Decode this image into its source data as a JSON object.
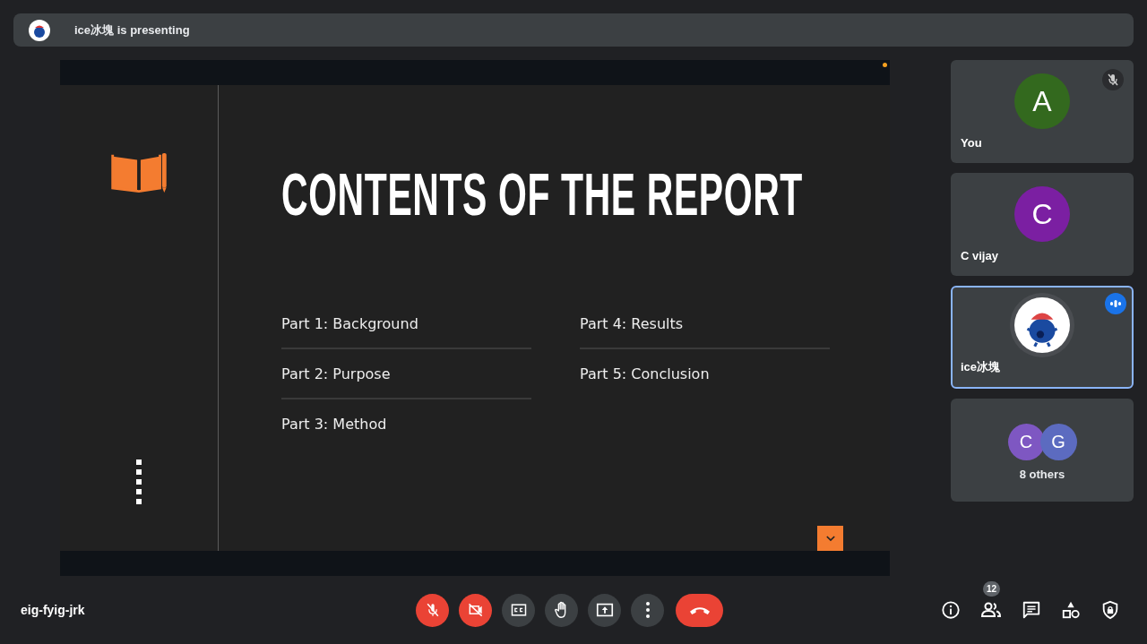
{
  "banner": {
    "text": "ice冰塊 is presenting"
  },
  "slide": {
    "title": "CONTENTS OF THE REPORT",
    "columns": [
      [
        "Part 1: Background",
        "Part 2: Purpose",
        "Part 3: Method"
      ],
      [
        "Part 4: Results",
        "Part 5: Conclusion"
      ]
    ]
  },
  "participants": [
    {
      "kind": "initial",
      "initial": "A",
      "name": "You",
      "color": "#33691e",
      "muted": true,
      "speaking": false
    },
    {
      "kind": "initial",
      "initial": "C",
      "name": "C vijay",
      "color": "#7b1fa2",
      "muted": false,
      "speaking": false
    },
    {
      "kind": "picture",
      "name": "ice冰塊",
      "muted": false,
      "speaking": true
    }
  ],
  "others": {
    "avatars": [
      {
        "initial": "C",
        "color": "#7e57c2"
      },
      {
        "initial": "G",
        "color": "#5c6bc0"
      }
    ],
    "label": "8 others"
  },
  "meeting_code": "eig-fyig-jrk",
  "controls": [
    {
      "kind": "mic",
      "on": false
    },
    {
      "kind": "camera",
      "on": false
    },
    {
      "kind": "captions",
      "on": false
    },
    {
      "kind": "hand",
      "on": false
    },
    {
      "kind": "present"
    },
    {
      "kind": "more"
    },
    {
      "kind": "leave"
    }
  ],
  "people_count": "12"
}
